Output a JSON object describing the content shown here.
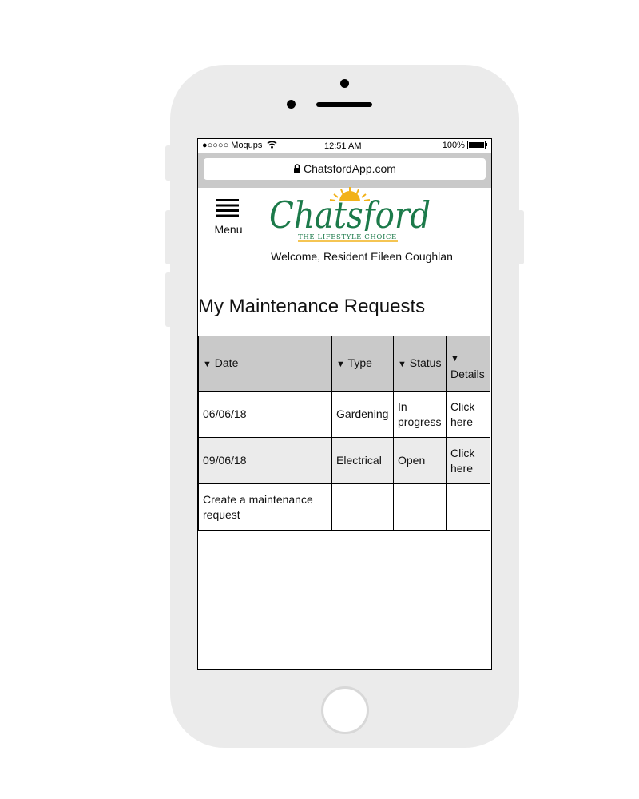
{
  "status_bar": {
    "carrier": "●○○○○ Moqups",
    "time": "12:51 AM",
    "battery": "100%"
  },
  "browser": {
    "url": "ChatsfordApp.com"
  },
  "header": {
    "menu_label": "Menu",
    "logo": {
      "name": "Chatsford",
      "tagline": "THE LIFESTYLE CHOICE"
    },
    "welcome": "Welcome, Resident Eileen Coughlan"
  },
  "page": {
    "title": "My Maintenance Requests"
  },
  "table": {
    "sort_indicator": "▼",
    "columns": [
      "Date",
      "Type",
      "Status",
      "Details"
    ],
    "rows": [
      {
        "date": "06/06/18",
        "type": "Gardening",
        "status": "In progress",
        "details": "Click here"
      },
      {
        "date": "09/06/18",
        "type": "Electrical",
        "status": "Open",
        "details": "Click here"
      }
    ],
    "create_link": "Create a maintenance request"
  },
  "colors": {
    "brand_green": "#1c7a4a",
    "brand_sun": "#f2b21a",
    "header_row": "#c9c9c9",
    "alt_row": "#ebebeb",
    "device_body": "#ebebeb"
  }
}
